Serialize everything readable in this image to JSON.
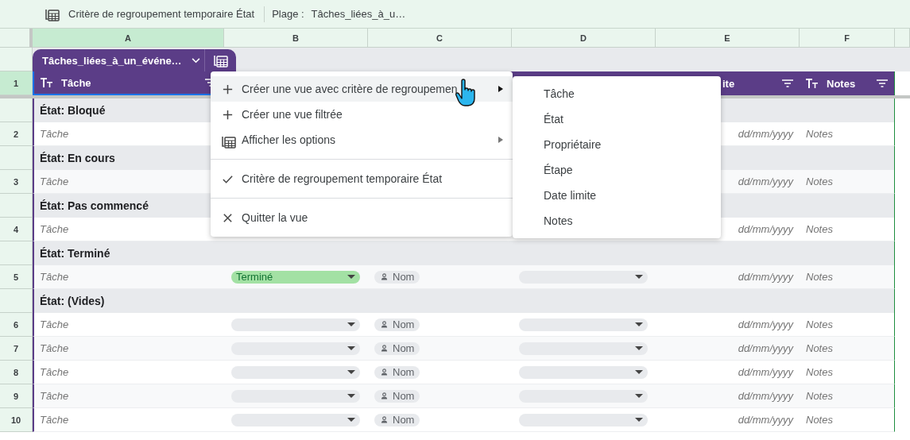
{
  "toolbar": {
    "view_title": "Critère de regroupement temporaire État",
    "range_label": "Plage :",
    "range_value": "Tâches_liées_à_u…"
  },
  "columns": [
    {
      "letter": "A",
      "selected": true
    },
    {
      "letter": "B",
      "selected": false
    },
    {
      "letter": "C",
      "selected": false
    },
    {
      "letter": "D",
      "selected": false
    },
    {
      "letter": "E",
      "selected": false
    },
    {
      "letter": "F",
      "selected": false
    }
  ],
  "table": {
    "name": "Tâches_liées_à_un_événe…",
    "header": {
      "number": "1",
      "selected": true,
      "task": "Tâche",
      "date_tail": "ite",
      "notes": "Notes"
    },
    "rows": [
      {
        "kind": "group",
        "label": "État: Bloqué"
      },
      {
        "kind": "data",
        "number": "2",
        "task": "Tâche",
        "date": "dd/mm/yyyy",
        "notes": "Notes"
      },
      {
        "kind": "group",
        "label": "État: En cours"
      },
      {
        "kind": "data",
        "number": "3",
        "task": "Tâche",
        "date": "dd/mm/yyyy",
        "notes": "Notes"
      },
      {
        "kind": "group",
        "label": "État: Pas commencé"
      },
      {
        "kind": "data",
        "number": "4",
        "task": "Tâche",
        "date": "dd/mm/yyyy",
        "notes": "Notes"
      },
      {
        "kind": "group",
        "label": "État: Terminé"
      },
      {
        "kind": "data",
        "number": "5",
        "task": "Tâche",
        "status": {
          "label": "Terminé",
          "color": "#a3e1a4"
        },
        "owner": "Nom",
        "stage_dropdown": true,
        "date": "dd/mm/yyyy",
        "notes": "Notes"
      },
      {
        "kind": "group",
        "label": "État: (Vides)"
      },
      {
        "kind": "data",
        "number": "6",
        "task": "Tâche",
        "status": {
          "color": "#e8eaed"
        },
        "owner": "Nom",
        "stage_dropdown": true,
        "date": "dd/mm/yyyy",
        "notes": "Notes"
      },
      {
        "kind": "data",
        "number": "7",
        "task": "Tâche",
        "status": {
          "color": "#e8eaed"
        },
        "owner": "Nom",
        "stage_dropdown": true,
        "date": "dd/mm/yyyy",
        "notes": "Notes"
      },
      {
        "kind": "data",
        "number": "8",
        "task": "Tâche",
        "status": {
          "color": "#e8eaed"
        },
        "owner": "Nom",
        "stage_dropdown": true,
        "date": "dd/mm/yyyy",
        "notes": "Notes"
      },
      {
        "kind": "data",
        "number": "9",
        "task": "Tâche",
        "status": {
          "color": "#e8eaed"
        },
        "owner": "Nom",
        "stage_dropdown": true,
        "date": "dd/mm/yyyy",
        "notes": "Notes"
      },
      {
        "kind": "data",
        "number": "10",
        "task": "Tâche",
        "status": {
          "color": "#e8eaed"
        },
        "owner": "Nom",
        "stage_dropdown": true,
        "date": "dd/mm/yyyy",
        "notes": "Notes"
      }
    ]
  },
  "menu": {
    "items": [
      {
        "label": "Créer une vue avec critère de regroupemen",
        "selected": true,
        "submenu": true,
        "checked": false,
        "divider_before": false
      },
      {
        "label": "Créer une vue filtrée",
        "selected": false,
        "submenu": false,
        "checked": false,
        "divider_before": false
      },
      {
        "label": "Afficher les options",
        "selected": false,
        "submenu": true,
        "checked": false,
        "divider_before": false
      },
      {
        "label": "Critère de regroupement temporaire État",
        "selected": false,
        "submenu": false,
        "checked": true,
        "divider_before": true
      },
      {
        "label": "Quitter la vue",
        "selected": false,
        "submenu": false,
        "checked": false,
        "divider_before": true
      }
    ]
  },
  "submenu": {
    "items": [
      {
        "label": "Tâche"
      },
      {
        "label": "État"
      },
      {
        "label": "Propriétaire"
      },
      {
        "label": "Étape"
      },
      {
        "label": "Date limite"
      },
      {
        "label": "Notes"
      }
    ]
  }
}
